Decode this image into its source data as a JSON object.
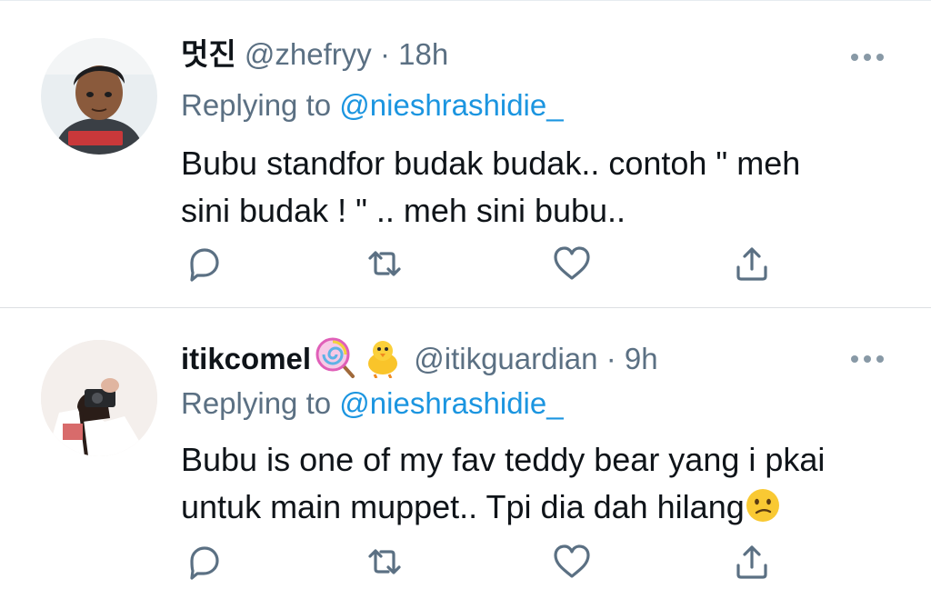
{
  "tweets": [
    {
      "display_name": "멋진",
      "handle": "@zhefryy",
      "separator": "·",
      "time": "18h",
      "reply_prefix": "Replying to",
      "reply_to": "@nieshrashidie_",
      "body_lines": [
        "Bubu standfor budak budak.. contoh \" meh",
        "sini budak ! \" .. meh sini bubu.."
      ],
      "emoji": []
    },
    {
      "display_name": "itikcomel",
      "name_emojis": [
        "lollipop-emoji",
        "chick-emoji"
      ],
      "handle": "@itikguardian",
      "separator": "·",
      "time": "9h",
      "reply_prefix": "Replying to",
      "reply_to": "@nieshrashidie_",
      "body_lines": [
        "Bubu is one of my fav teddy bear yang i pkai",
        "untuk main muppet.. Tpi dia dah hilang"
      ],
      "trailing_emoji": "confused-face-emoji"
    }
  ],
  "colors": {
    "text": "#0f1419",
    "secondary": "#5b7083",
    "link": "#1b95e0",
    "divider": "#dcdfe2"
  }
}
